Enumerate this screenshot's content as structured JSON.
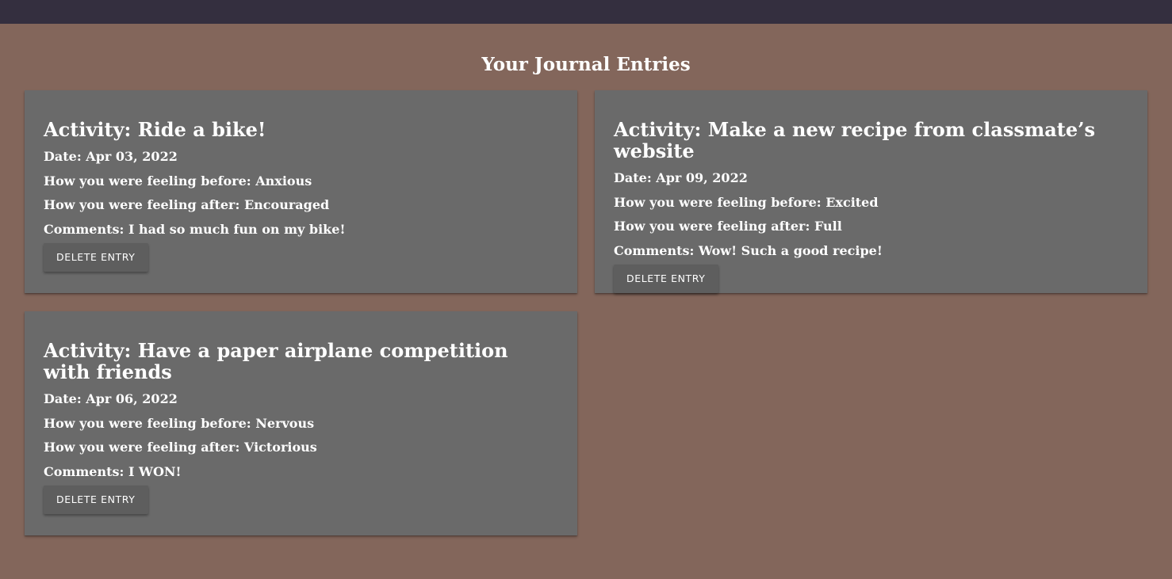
{
  "page": {
    "title": "Your Journal Entries",
    "colors": {
      "background": "#83665b",
      "topbar": "#342f3f",
      "card": "#6a6a6a",
      "text": "#ffffff"
    }
  },
  "entries": [
    {
      "activity": "Activity: Ride a bike!",
      "date": "Date: Apr 03, 2022",
      "before": "How you were feeling before: Anxious",
      "after": "How you were feeling after: Encouraged",
      "comments": "Comments: I had so much fun on my bike!",
      "delete_label": "DELETE ENTRY"
    },
    {
      "activity": "Activity: Make a new recipe from classmate’s website",
      "date": "Date: Apr 09, 2022",
      "before": "How you were feeling before: Excited",
      "after": "How you were feeling after: Full",
      "comments": "Comments: Wow! Such a good recipe!",
      "delete_label": "DELETE ENTRY"
    },
    {
      "activity": "Activity: Have a paper airplane competition with friends",
      "date": "Date: Apr 06, 2022",
      "before": "How you were feeling before: Nervous",
      "after": "How you were feeling after: Victorious",
      "comments": "Comments: I WON!",
      "delete_label": "DELETE ENTRY"
    }
  ]
}
